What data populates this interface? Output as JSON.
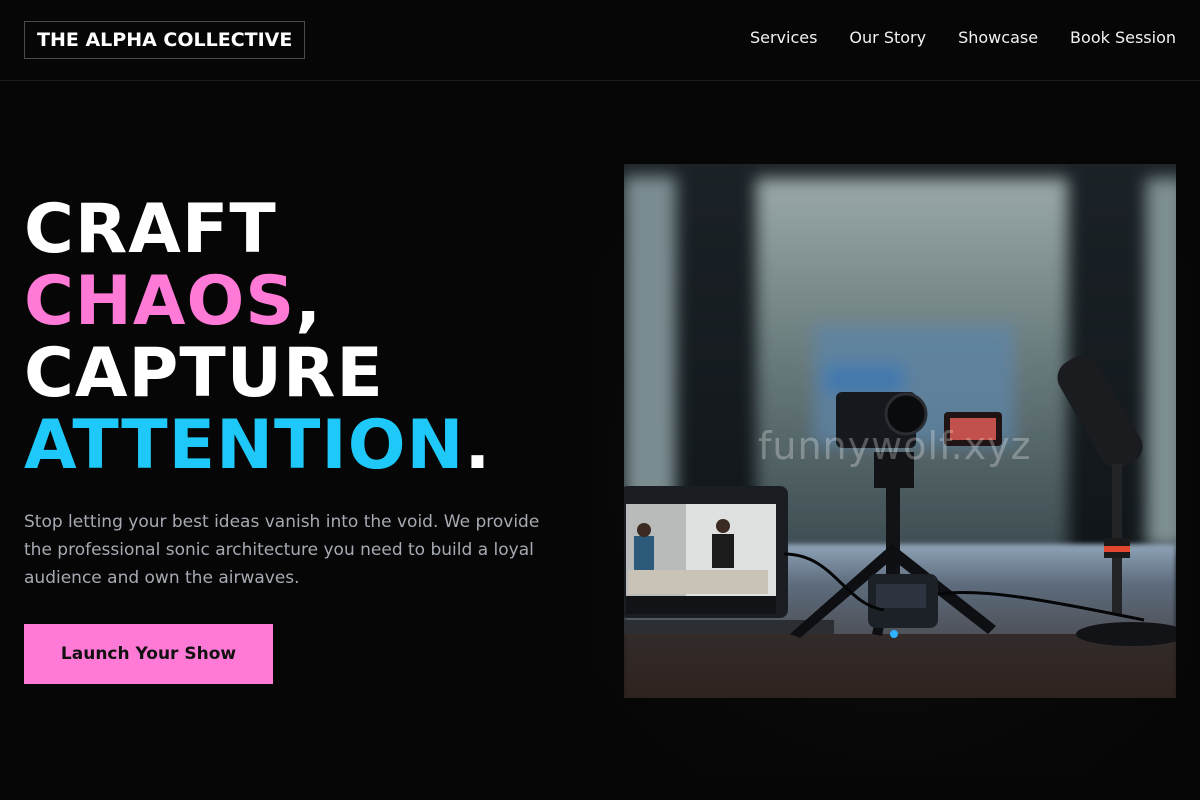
{
  "brand": {
    "logo_text": "THE ALPHA COLLECTIVE"
  },
  "nav": {
    "items": [
      {
        "label": "Services"
      },
      {
        "label": "Our Story"
      },
      {
        "label": "Showcase"
      },
      {
        "label": "Book Session"
      }
    ]
  },
  "hero": {
    "line1": "CRAFT",
    "line2_highlight": "CHAOS",
    "line2_punct": ",",
    "line3": "CAPTURE",
    "line4_highlight": "ATTENTION",
    "line4_punct": ".",
    "subtitle": "Stop letting your best ideas vanish into the void. We provide the professional sonic architecture you need to build a loyal audience and own the airwaves.",
    "cta_label": "Launch Your Show"
  },
  "media": {
    "watermark_text": "funnywolf.xyz",
    "icon": "podcast-studio-photo"
  },
  "colors": {
    "background": "#060606",
    "accent_pink": "#ff7ad6",
    "accent_cyan": "#1ec8f8",
    "body_text": "#a6aab3"
  }
}
